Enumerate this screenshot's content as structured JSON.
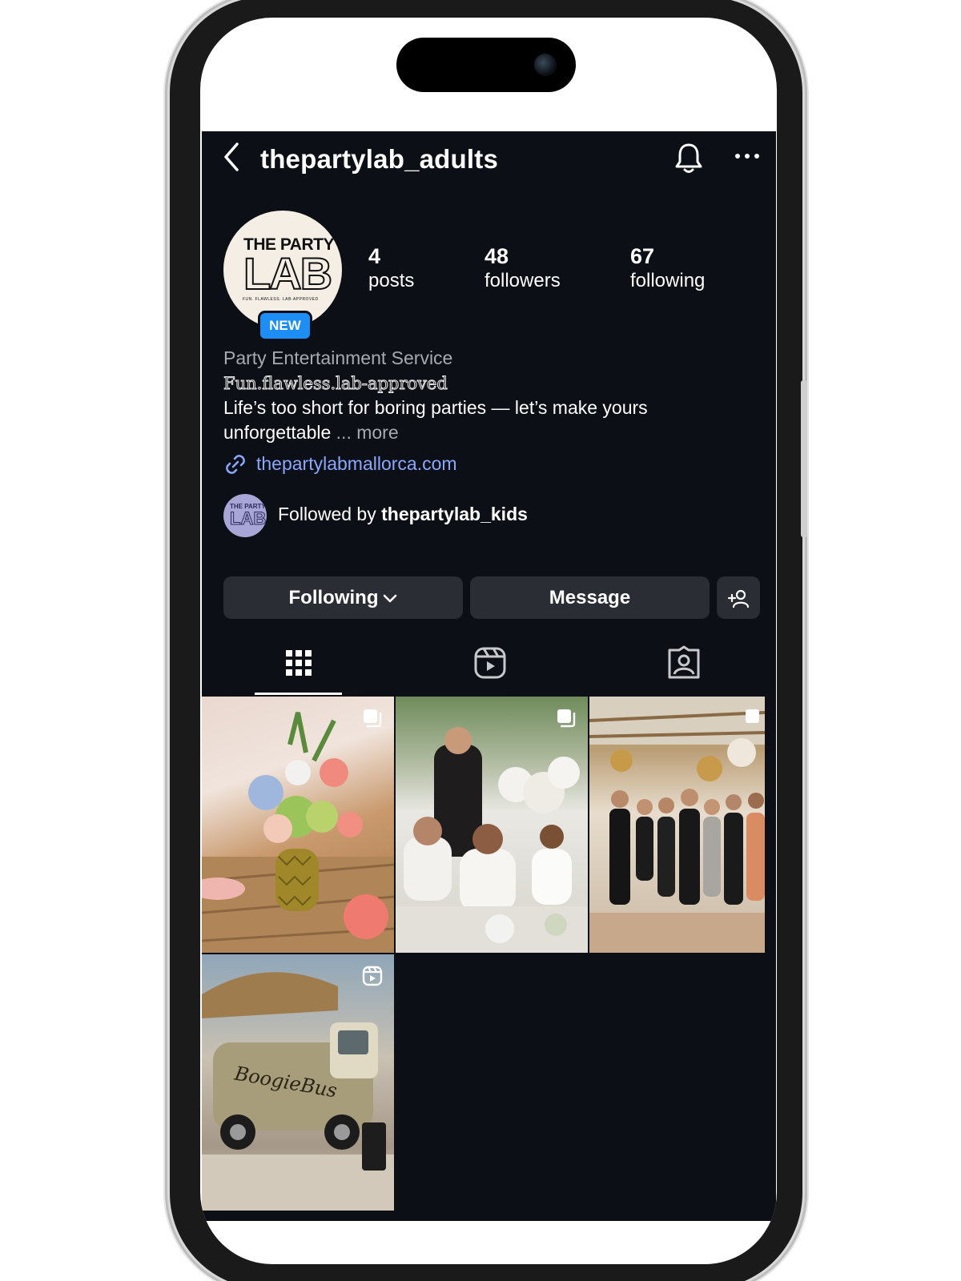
{
  "header": {
    "username": "thepartylab_adults"
  },
  "profile": {
    "avatar": {
      "line1": "THE PARTY",
      "line2": "LAB",
      "tagline": "FUN. FLAWLESS. LAB-APPROVED"
    },
    "badge": "NEW",
    "stats": [
      {
        "value": "4",
        "label": "posts"
      },
      {
        "value": "48",
        "label": "followers"
      },
      {
        "value": "67",
        "label": "following"
      }
    ],
    "category": "Party Entertainment Service",
    "bio_fancy": "Fun.flawless.lab-approved",
    "bio_line1": "Life’s too short for boring parties — let’s make yours",
    "bio_line2": "unforgettable",
    "bio_more": "... more",
    "link": "thepartylabmallorca.com"
  },
  "followed_by": {
    "prefix": "Followed by",
    "user": "thepartylab_kids",
    "avatar_line1": "THE PARTY",
    "avatar_line2": "LAB"
  },
  "actions": {
    "following_label": "Following",
    "message_label": "Message"
  },
  "tabs": [
    {
      "icon": "grid-icon",
      "active": true
    },
    {
      "icon": "reels-icon",
      "active": false
    },
    {
      "icon": "tagged-icon",
      "active": false
    }
  ],
  "posts": [
    {
      "subject": "flower-arrangement",
      "type": "carousel"
    },
    {
      "subject": "dinner-party",
      "type": "carousel"
    },
    {
      "subject": "group-arrival",
      "type": "carousel"
    },
    {
      "subject": "boogie-bus",
      "type": "reel",
      "text": "BoogieBus"
    }
  ],
  "colors": {
    "background": "#0c0f15",
    "accent": "#1c8ef5",
    "link": "#8aa6ff",
    "button": "#2a2d33"
  }
}
